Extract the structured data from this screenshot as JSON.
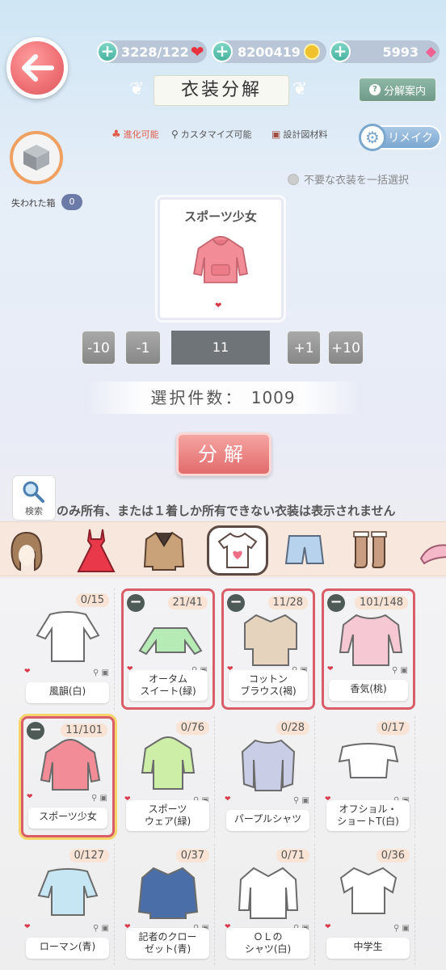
{
  "header": {
    "resources": {
      "stamina": "3228/122",
      "coins": "8200419",
      "diamonds": "5993"
    },
    "title": "衣装分解",
    "guide_label": "分解案内"
  },
  "legend": {
    "evolve": "進化可能",
    "customize": "カスタマイズ可能",
    "blueprint": "設計図材料",
    "remake": "リメイク"
  },
  "lost_box": {
    "label": "失われた箱",
    "count": "0"
  },
  "bulk_select_label": "不要な衣装を一括選択",
  "preview": {
    "name": "スポーツ少女"
  },
  "quantity": {
    "minus10": "-10",
    "minus1": "-1",
    "value": "11",
    "plus1": "+1",
    "plus10": "+10"
  },
  "selected_count": {
    "label": "選択件数：",
    "value": "1009"
  },
  "decompose_label": "分解",
  "search_label": "検索",
  "notice": "のみ所有、または１着しか所有できない衣装は表示されません",
  "categories": [
    "hair",
    "dress",
    "coat",
    "top",
    "bottom",
    "socks",
    "shoes"
  ],
  "items": [
    {
      "name": "風韻(白)",
      "count": "0/15",
      "selected": false,
      "color": "#ffffff"
    },
    {
      "name": "オータム\nスイート(緑)",
      "count": "21/41",
      "selected": true,
      "color": "#b7ebb5"
    },
    {
      "name": "コットン\nブラウス(褐)",
      "count": "11/28",
      "selected": true,
      "color": "#e6d3be"
    },
    {
      "name": "香気(桃)",
      "count": "101/148",
      "selected": true,
      "color": "#f6c8d3"
    },
    {
      "name": "スポーツ少女",
      "count": "11/101",
      "selected": true,
      "color": "#f28d98"
    },
    {
      "name": "スポーツ\nウェア(緑)",
      "count": "0/76",
      "selected": false,
      "color": "#cdeea7"
    },
    {
      "name": "パープルシャツ",
      "count": "0/28",
      "selected": false,
      "color": "#c9cde6"
    },
    {
      "name": "オフショル・\nショートT(白)",
      "count": "0/17",
      "selected": false,
      "color": "#ffffff"
    },
    {
      "name": "ローマン(青)",
      "count": "0/127",
      "selected": false,
      "color": "#c6e6f3"
    },
    {
      "name": "記者のクロー\nゼット(青)",
      "count": "0/37",
      "selected": false,
      "color": "#4a6ea8"
    },
    {
      "name": "ＯＬの\nシャツ(白)",
      "count": "0/71",
      "selected": false,
      "color": "#ffffff"
    },
    {
      "name": "中学生",
      "count": "0/36",
      "selected": false,
      "color": "#ffffff"
    }
  ]
}
